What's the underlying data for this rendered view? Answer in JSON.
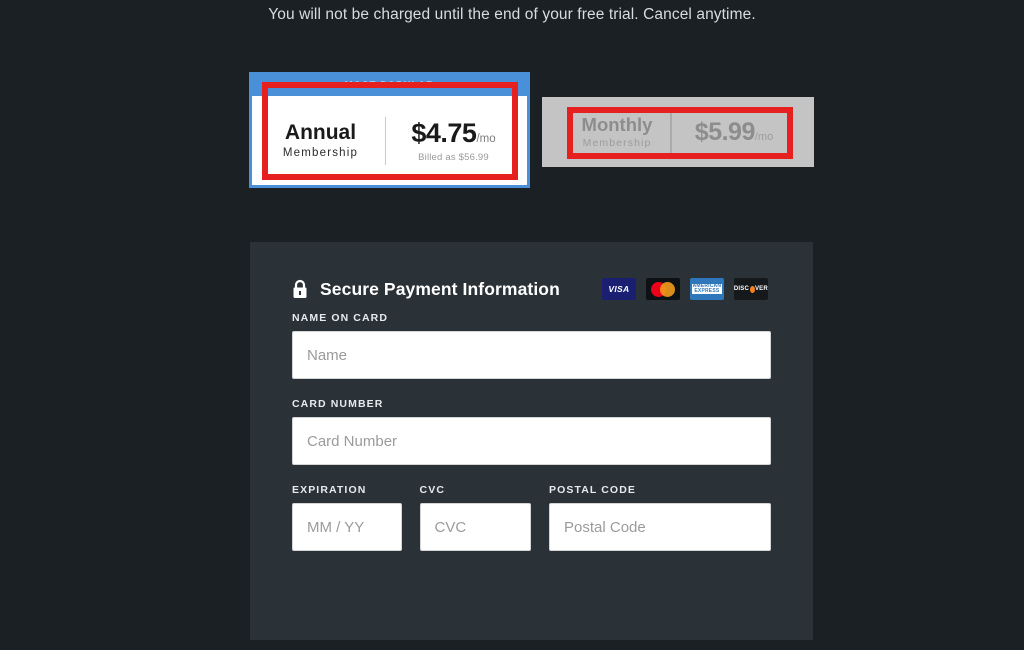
{
  "trial": {
    "notice": "You will not be charged until the end of your free trial. Cancel anytime."
  },
  "plans": {
    "annual": {
      "banner": "MOST POPULAR",
      "name": "Annual",
      "subtitle": "Membership",
      "price": "$4.75",
      "per": "/mo",
      "billed_as": "Billed as $56.99",
      "selected": true,
      "accent_color": "#4a90d9"
    },
    "monthly": {
      "name": "Monthly",
      "subtitle": "Membership",
      "price": "$5.99",
      "per": "/mo",
      "selected": false,
      "background_color": "#c4c4c4"
    },
    "highlight_color": "#e5201e"
  },
  "payment": {
    "title": "Secure Payment Information",
    "lock_icon": "lock-icon",
    "accepted_cards": [
      {
        "name": "visa-logo",
        "label": "VISA"
      },
      {
        "name": "mastercard-logo",
        "label": ""
      },
      {
        "name": "amex-logo",
        "label": "AMERICAN",
        "label2": "EXPRESS"
      },
      {
        "name": "discover-logo",
        "label": "DISC",
        "label2": "VER"
      }
    ],
    "fields": {
      "name_on_card": {
        "label": "NAME ON CARD",
        "placeholder": "Name",
        "value": ""
      },
      "card_number": {
        "label": "CARD NUMBER",
        "placeholder": "Card Number",
        "value": ""
      },
      "expiration": {
        "label": "EXPIRATION",
        "placeholder": "MM / YY",
        "value": ""
      },
      "cvc": {
        "label": "CVC",
        "placeholder": "CVC",
        "value": ""
      },
      "postal_code": {
        "label": "POSTAL CODE",
        "placeholder": "Postal Code",
        "value": ""
      }
    }
  },
  "theme": {
    "page_background": "#1a2023",
    "panel_background": "#2b3237"
  }
}
